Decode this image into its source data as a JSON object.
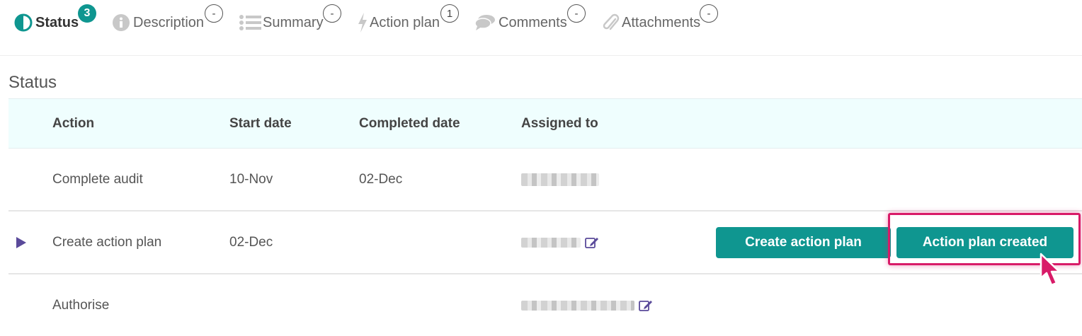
{
  "tabs": [
    {
      "label": "Status",
      "badge": "3",
      "icon": "half-circle-icon",
      "active": true
    },
    {
      "label": "Description",
      "badge": "-",
      "icon": "info-icon"
    },
    {
      "label": "Summary",
      "badge": "-",
      "icon": "list-icon"
    },
    {
      "label": "Action plan",
      "badge": "1",
      "icon": "lightning-icon"
    },
    {
      "label": "Comments",
      "badge": "-",
      "icon": "comments-icon"
    },
    {
      "label": "Attachments",
      "badge": "-",
      "icon": "paperclip-icon"
    }
  ],
  "section": {
    "title": "Status"
  },
  "table": {
    "columns": [
      "Action",
      "Start date",
      "Completed date",
      "Assigned to"
    ],
    "rows": [
      {
        "action": "Complete audit",
        "start_date": "10-Nov",
        "completed_date": "02-Dec",
        "assigned_to": "[redacted]"
      },
      {
        "action": "Create action plan",
        "start_date": "02-Dec",
        "completed_date": "",
        "assigned_to": "[redacted]",
        "current": true
      },
      {
        "action": "Authorise",
        "start_date": "",
        "completed_date": "",
        "assigned_to": "[redacted]"
      }
    ]
  },
  "buttons": {
    "create_action_plan": "Create action plan",
    "action_plan_created": "Action plan created"
  },
  "colors": {
    "accent": "#0f9690",
    "header_bg": "#effefe",
    "highlight": "#d81b68",
    "row_marker": "#5a4a9a"
  }
}
